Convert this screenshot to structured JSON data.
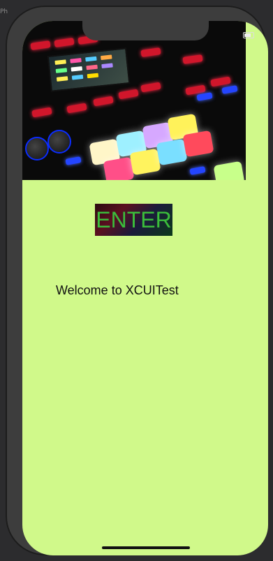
{
  "status_bar": {
    "left_text": "Ph"
  },
  "hero": {
    "image_name": "music-controller-photo"
  },
  "enter_button": {
    "label": "ENTER"
  },
  "welcome": {
    "text": "Welcome to XCUITest"
  },
  "colors": {
    "screen_bg": "#d0f98a",
    "enter_text": "#3bbd3b",
    "device_frame": "#3d3d3d"
  }
}
